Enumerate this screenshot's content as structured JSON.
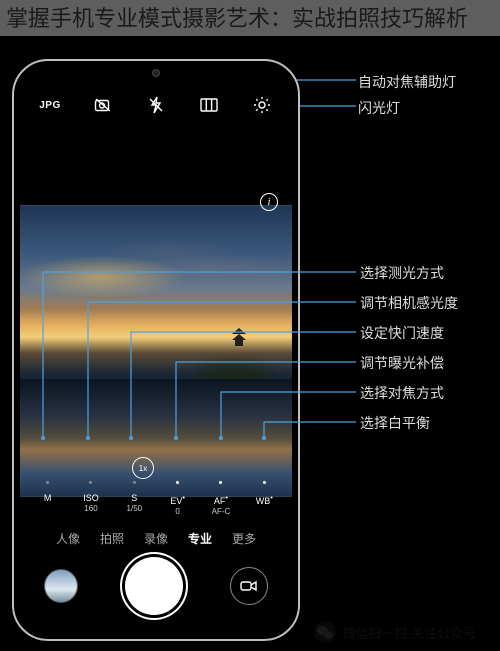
{
  "title": "掌握手机专业模式摄影艺术：实战拍照技巧解析",
  "top_toolbar": {
    "jpg": "JPG"
  },
  "info_icon": "i",
  "zoom": "1x",
  "pro_params": [
    {
      "label": "M",
      "value": "",
      "callout": "选择测光方式"
    },
    {
      "label": "ISO",
      "value": "160",
      "callout": "调节相机感光度"
    },
    {
      "label": "S",
      "value": "1/50",
      "callout": "设定快门速度"
    },
    {
      "label": "EV",
      "value": "0",
      "callout": "调节曝光补偿",
      "suffix": "•"
    },
    {
      "label": "AF",
      "value": "AF-C",
      "callout": "选择对焦方式",
      "suffix": "•"
    },
    {
      "label": "WB",
      "value": "",
      "callout": "选择白平衡",
      "suffix": "•"
    }
  ],
  "top_callouts": {
    "af_assist": "自动对焦辅助灯",
    "flash": "闪光灯"
  },
  "modes": {
    "items": [
      "人像",
      "拍照",
      "录像",
      "专业",
      "更多"
    ],
    "active_index": 3
  },
  "watermark": "微信扫一扫 关注公众号"
}
